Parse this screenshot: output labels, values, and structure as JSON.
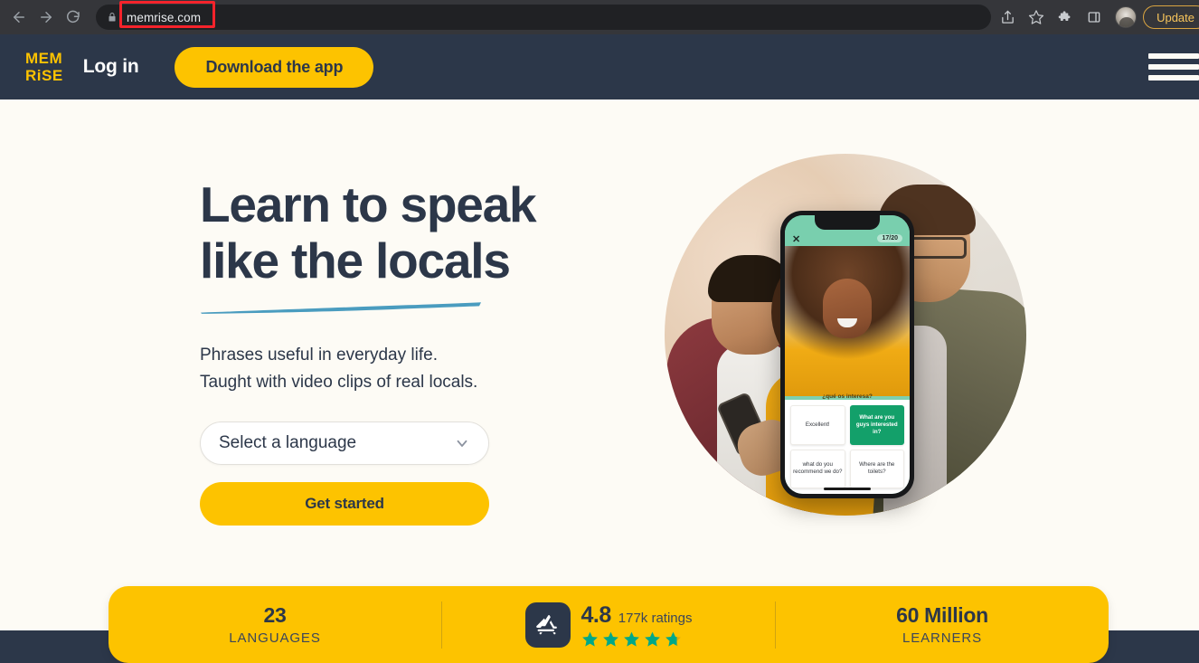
{
  "browser": {
    "back_icon": "back-arrow-icon",
    "forward_icon": "forward-arrow-icon",
    "reload_icon": "reload-icon",
    "lock_icon": "lock-icon",
    "url": "memrise.com",
    "highlight_color": "#F5232B",
    "toolbar_icons": [
      "share-icon",
      "bookmark-star-icon",
      "extensions-puzzle-icon",
      "side-panel-icon",
      "profile-avatar"
    ],
    "update_label": "Update"
  },
  "header": {
    "logo_line1": "MEM",
    "logo_line2": "RiSE",
    "login_label": "Log in",
    "download_label": "Download the app",
    "menu_icon": "hamburger-menu-icon",
    "bg_color": "#2C3749",
    "accent_color": "#FDC300"
  },
  "hero": {
    "headline_line1": "Learn to speak",
    "headline_line2": "like the locals",
    "brush_color": "#4A9CBF",
    "sub_line1": "Phrases useful in everyday life.",
    "sub_line2": "Taught with video clips of real locals.",
    "select_placeholder": "Select a language",
    "select_chevron": "chevron-down-icon",
    "cta_label": "Get started",
    "bg_color": "#FDFBF5"
  },
  "phone": {
    "close_icon": "✕",
    "counter": "17/20",
    "prompt": "¿qué os interesa?",
    "cards": [
      {
        "text": "Excellent!",
        "selected": false
      },
      {
        "text": "What are you guys interested in?",
        "selected": true
      },
      {
        "text": "what do you recommend we do?",
        "selected": false
      },
      {
        "text": "Where are the toilets?",
        "selected": false
      }
    ],
    "selected_color": "#13A06A"
  },
  "stats": {
    "bg_color": "#FDC300",
    "items": [
      {
        "value": "23",
        "label": "LANGUAGES"
      },
      {
        "value": "60 Million",
        "label": "LEARNERS"
      }
    ],
    "rating": {
      "icon": "app-store-icon",
      "score": "4.8",
      "count": "177k ratings",
      "star_count": 5,
      "star_color": "#00A887"
    }
  }
}
